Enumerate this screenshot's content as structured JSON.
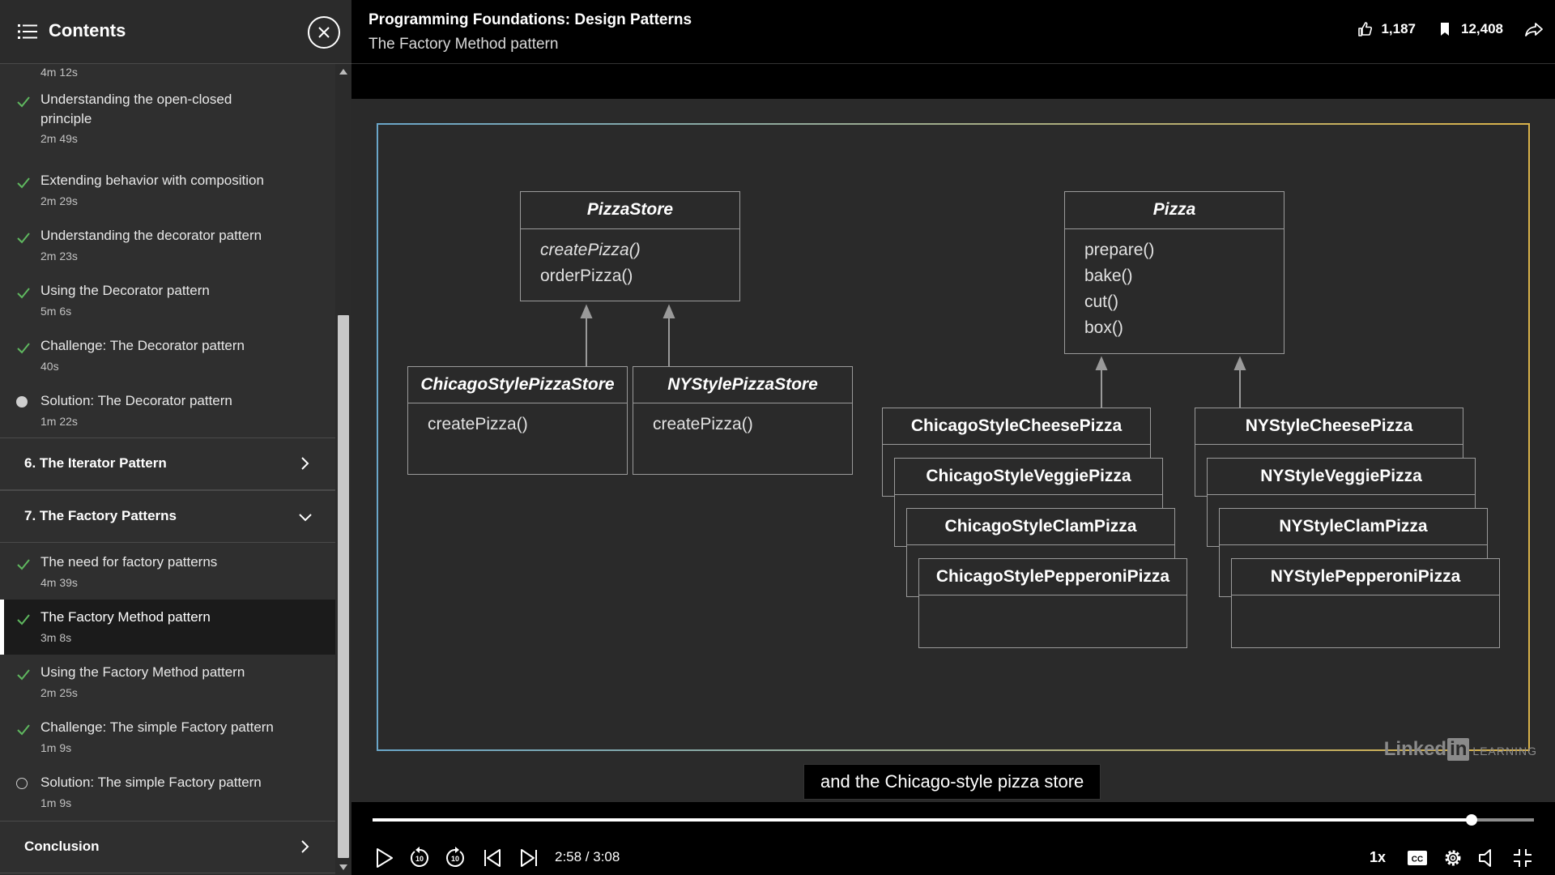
{
  "sidebar": {
    "title": "Contents",
    "top_partial_duration": "4m 12s",
    "lessons_a": [
      {
        "title": "Understanding the open-closed principle",
        "duration": "2m 49s",
        "status": "done"
      },
      {
        "title": "Extending behavior with composition",
        "duration": "2m 29s",
        "status": "done"
      },
      {
        "title": "Understanding the decorator pattern",
        "duration": "2m 23s",
        "status": "done"
      },
      {
        "title": "Using the Decorator pattern",
        "duration": "5m 6s",
        "status": "done"
      },
      {
        "title": "Challenge: The Decorator pattern",
        "duration": "40s",
        "status": "done"
      },
      {
        "title": "Solution: The Decorator pattern",
        "duration": "1m 22s",
        "status": "in-progress"
      }
    ],
    "sections": {
      "iterator": "6. The Iterator Pattern",
      "factory": "7. The Factory Patterns",
      "conclusion": "Conclusion"
    },
    "lessons_b": [
      {
        "title": "The need for factory patterns",
        "duration": "4m 39s",
        "status": "done"
      },
      {
        "title": "The Factory Method pattern",
        "duration": "3m 8s",
        "status": "done",
        "active": true
      },
      {
        "title": "Using the Factory Method pattern",
        "duration": "2m 25s",
        "status": "done"
      },
      {
        "title": "Challenge: The simple Factory pattern",
        "duration": "1m 9s",
        "status": "done"
      },
      {
        "title": "Solution: The simple Factory pattern",
        "duration": "1m 9s",
        "status": "not-started"
      }
    ]
  },
  "header": {
    "course_title": "Programming Foundations: Design Patterns",
    "video_title": "The Factory Method pattern",
    "likes": "1,187",
    "saves": "12,408"
  },
  "diagram": {
    "pizzastore": {
      "name": "PizzaStore",
      "methods": [
        "createPizza()",
        "orderPizza()"
      ]
    },
    "chicago_store": {
      "name": "ChicagoStylePizzaStore",
      "methods": [
        "createPizza()"
      ]
    },
    "ny_store": {
      "name": "NYStylePizzaStore",
      "methods": [
        "createPizza()"
      ]
    },
    "pizza": {
      "name": "Pizza",
      "methods": [
        "prepare()",
        "bake()",
        "cut()",
        "box()"
      ]
    },
    "chicago_pizzas": [
      "ChicagoStyleCheesePizza",
      "ChicagoStyleVeggiePizza",
      "ChicagoStyleClamPizza",
      "ChicagoStylePepperoniPizza"
    ],
    "ny_pizzas": [
      "NYStyleCheesePizza",
      "NYStyleVeggiePizza",
      "NYStyleClamPizza",
      "NYStylePepperoniPizza"
    ]
  },
  "watermark": {
    "brand_a": "Linked",
    "brand_b": "in",
    "brand_c": "LEARNING"
  },
  "caption": "and the Chicago-style pizza store",
  "player": {
    "time": "2:58 / 3:08",
    "progress": 0.946,
    "speed": "1x"
  },
  "colors": {
    "check": "#5fb85f",
    "sidebar_bg": "#2f2f2f",
    "active_bg": "#1b1b1b",
    "slide_bg": "#2a2a2a",
    "frame_left": "#6aa6c8",
    "frame_right": "#d9b24a"
  }
}
